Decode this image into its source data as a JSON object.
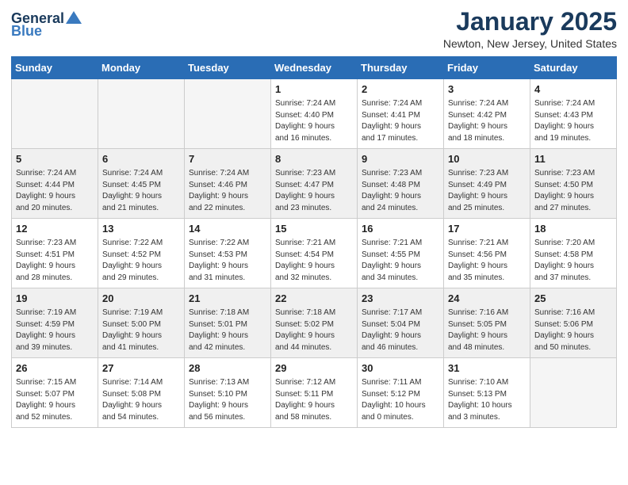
{
  "header": {
    "logo_general": "General",
    "logo_blue": "Blue",
    "month_title": "January 2025",
    "location": "Newton, New Jersey, United States"
  },
  "weekdays": [
    "Sunday",
    "Monday",
    "Tuesday",
    "Wednesday",
    "Thursday",
    "Friday",
    "Saturday"
  ],
  "weeks": [
    [
      {
        "day": "",
        "info": ""
      },
      {
        "day": "",
        "info": ""
      },
      {
        "day": "",
        "info": ""
      },
      {
        "day": "1",
        "info": "Sunrise: 7:24 AM\nSunset: 4:40 PM\nDaylight: 9 hours\nand 16 minutes."
      },
      {
        "day": "2",
        "info": "Sunrise: 7:24 AM\nSunset: 4:41 PM\nDaylight: 9 hours\nand 17 minutes."
      },
      {
        "day": "3",
        "info": "Sunrise: 7:24 AM\nSunset: 4:42 PM\nDaylight: 9 hours\nand 18 minutes."
      },
      {
        "day": "4",
        "info": "Sunrise: 7:24 AM\nSunset: 4:43 PM\nDaylight: 9 hours\nand 19 minutes."
      }
    ],
    [
      {
        "day": "5",
        "info": "Sunrise: 7:24 AM\nSunset: 4:44 PM\nDaylight: 9 hours\nand 20 minutes."
      },
      {
        "day": "6",
        "info": "Sunrise: 7:24 AM\nSunset: 4:45 PM\nDaylight: 9 hours\nand 21 minutes."
      },
      {
        "day": "7",
        "info": "Sunrise: 7:24 AM\nSunset: 4:46 PM\nDaylight: 9 hours\nand 22 minutes."
      },
      {
        "day": "8",
        "info": "Sunrise: 7:23 AM\nSunset: 4:47 PM\nDaylight: 9 hours\nand 23 minutes."
      },
      {
        "day": "9",
        "info": "Sunrise: 7:23 AM\nSunset: 4:48 PM\nDaylight: 9 hours\nand 24 minutes."
      },
      {
        "day": "10",
        "info": "Sunrise: 7:23 AM\nSunset: 4:49 PM\nDaylight: 9 hours\nand 25 minutes."
      },
      {
        "day": "11",
        "info": "Sunrise: 7:23 AM\nSunset: 4:50 PM\nDaylight: 9 hours\nand 27 minutes."
      }
    ],
    [
      {
        "day": "12",
        "info": "Sunrise: 7:23 AM\nSunset: 4:51 PM\nDaylight: 9 hours\nand 28 minutes."
      },
      {
        "day": "13",
        "info": "Sunrise: 7:22 AM\nSunset: 4:52 PM\nDaylight: 9 hours\nand 29 minutes."
      },
      {
        "day": "14",
        "info": "Sunrise: 7:22 AM\nSunset: 4:53 PM\nDaylight: 9 hours\nand 31 minutes."
      },
      {
        "day": "15",
        "info": "Sunrise: 7:21 AM\nSunset: 4:54 PM\nDaylight: 9 hours\nand 32 minutes."
      },
      {
        "day": "16",
        "info": "Sunrise: 7:21 AM\nSunset: 4:55 PM\nDaylight: 9 hours\nand 34 minutes."
      },
      {
        "day": "17",
        "info": "Sunrise: 7:21 AM\nSunset: 4:56 PM\nDaylight: 9 hours\nand 35 minutes."
      },
      {
        "day": "18",
        "info": "Sunrise: 7:20 AM\nSunset: 4:58 PM\nDaylight: 9 hours\nand 37 minutes."
      }
    ],
    [
      {
        "day": "19",
        "info": "Sunrise: 7:19 AM\nSunset: 4:59 PM\nDaylight: 9 hours\nand 39 minutes."
      },
      {
        "day": "20",
        "info": "Sunrise: 7:19 AM\nSunset: 5:00 PM\nDaylight: 9 hours\nand 41 minutes."
      },
      {
        "day": "21",
        "info": "Sunrise: 7:18 AM\nSunset: 5:01 PM\nDaylight: 9 hours\nand 42 minutes."
      },
      {
        "day": "22",
        "info": "Sunrise: 7:18 AM\nSunset: 5:02 PM\nDaylight: 9 hours\nand 44 minutes."
      },
      {
        "day": "23",
        "info": "Sunrise: 7:17 AM\nSunset: 5:04 PM\nDaylight: 9 hours\nand 46 minutes."
      },
      {
        "day": "24",
        "info": "Sunrise: 7:16 AM\nSunset: 5:05 PM\nDaylight: 9 hours\nand 48 minutes."
      },
      {
        "day": "25",
        "info": "Sunrise: 7:16 AM\nSunset: 5:06 PM\nDaylight: 9 hours\nand 50 minutes."
      }
    ],
    [
      {
        "day": "26",
        "info": "Sunrise: 7:15 AM\nSunset: 5:07 PM\nDaylight: 9 hours\nand 52 minutes."
      },
      {
        "day": "27",
        "info": "Sunrise: 7:14 AM\nSunset: 5:08 PM\nDaylight: 9 hours\nand 54 minutes."
      },
      {
        "day": "28",
        "info": "Sunrise: 7:13 AM\nSunset: 5:10 PM\nDaylight: 9 hours\nand 56 minutes."
      },
      {
        "day": "29",
        "info": "Sunrise: 7:12 AM\nSunset: 5:11 PM\nDaylight: 9 hours\nand 58 minutes."
      },
      {
        "day": "30",
        "info": "Sunrise: 7:11 AM\nSunset: 5:12 PM\nDaylight: 10 hours\nand 0 minutes."
      },
      {
        "day": "31",
        "info": "Sunrise: 7:10 AM\nSunset: 5:13 PM\nDaylight: 10 hours\nand 3 minutes."
      },
      {
        "day": "",
        "info": ""
      }
    ]
  ]
}
